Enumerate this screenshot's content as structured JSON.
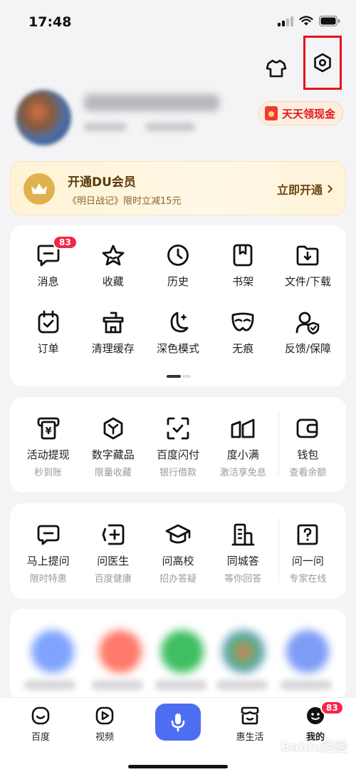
{
  "status": {
    "time": "17:48"
  },
  "profile": {
    "cash_label": "天天领现金"
  },
  "vip": {
    "title": "开通DU会员",
    "subtitle": "《明日战记》限时立减15元",
    "cta": "立即开通"
  },
  "menu": {
    "row1": [
      {
        "label": "消息",
        "icon": "message-icon",
        "badge": "83"
      },
      {
        "label": "收藏",
        "icon": "star-icon"
      },
      {
        "label": "历史",
        "icon": "clock-icon"
      },
      {
        "label": "书架",
        "icon": "bookshelf-icon"
      },
      {
        "label": "文件/下载",
        "icon": "download-folder-icon"
      }
    ],
    "row2": [
      {
        "label": "订单",
        "icon": "order-icon"
      },
      {
        "label": "清理缓存",
        "icon": "clean-cache-icon"
      },
      {
        "label": "深色模式",
        "icon": "moon-icon"
      },
      {
        "label": "无痕",
        "icon": "mask-icon"
      },
      {
        "label": "反馈/保障",
        "icon": "feedback-shield-icon"
      }
    ]
  },
  "finance": [
    {
      "label": "活动提现",
      "sub": "秒到账",
      "icon": "withdraw-icon"
    },
    {
      "label": "数字藏品",
      "sub": "限量收藏",
      "icon": "collectible-icon"
    },
    {
      "label": "百度闪付",
      "sub": "银行借款",
      "icon": "scan-pay-icon"
    },
    {
      "label": "度小满",
      "sub": "激活享免息",
      "icon": "duxiaoman-icon"
    },
    {
      "label": "钱包",
      "sub": "查看余额",
      "icon": "wallet-icon"
    }
  ],
  "services": [
    {
      "label": "马上提问",
      "sub": "限时特惠",
      "icon": "ask-icon"
    },
    {
      "label": "问医生",
      "sub": "百度健康",
      "icon": "doctor-icon"
    },
    {
      "label": "问高校",
      "sub": "招办答疑",
      "icon": "graduation-icon"
    },
    {
      "label": "同城答",
      "sub": "等你回答",
      "icon": "building-icon"
    },
    {
      "label": "问一问",
      "sub": "专家在线",
      "icon": "question-icon"
    }
  ],
  "tabbar": {
    "home": "百度",
    "video": "视频",
    "life": "惠生活",
    "mine": "我的",
    "mine_badge": "83"
  },
  "watermark": "Baidu经验"
}
